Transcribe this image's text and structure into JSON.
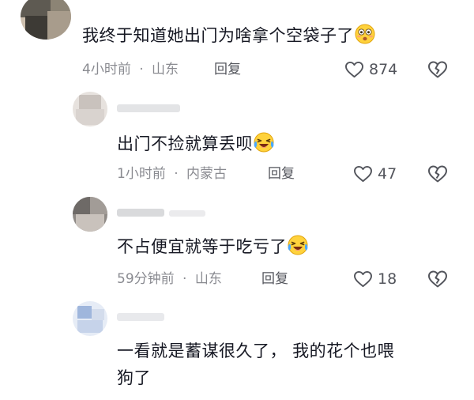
{
  "comments": [
    {
      "text": "我终于知道她出门为啥拿个空袋子了",
      "emoji": "flushed-face",
      "time": "4小时前",
      "location": "山东",
      "reply_label": "回复",
      "likes": "874"
    },
    {
      "text": "出门不捡就算丢呗",
      "emoji": "laughing-crying-face",
      "time": "1小时前",
      "location": "内蒙古",
      "reply_label": "回复",
      "likes": "47"
    },
    {
      "text": "不占便宜就等于吃亏了",
      "emoji": "laughing-crying-face",
      "time": "59分钟前",
      "location": "山东",
      "reply_label": "回复",
      "likes": "18"
    },
    {
      "text_line1": "一看就是蓄谋很久了， 我的花个也喂",
      "text_line2": "狗了"
    }
  ],
  "separator": "·",
  "colors": {
    "text": "#161823",
    "meta": "#8a8b91",
    "icon": "#53555c"
  }
}
